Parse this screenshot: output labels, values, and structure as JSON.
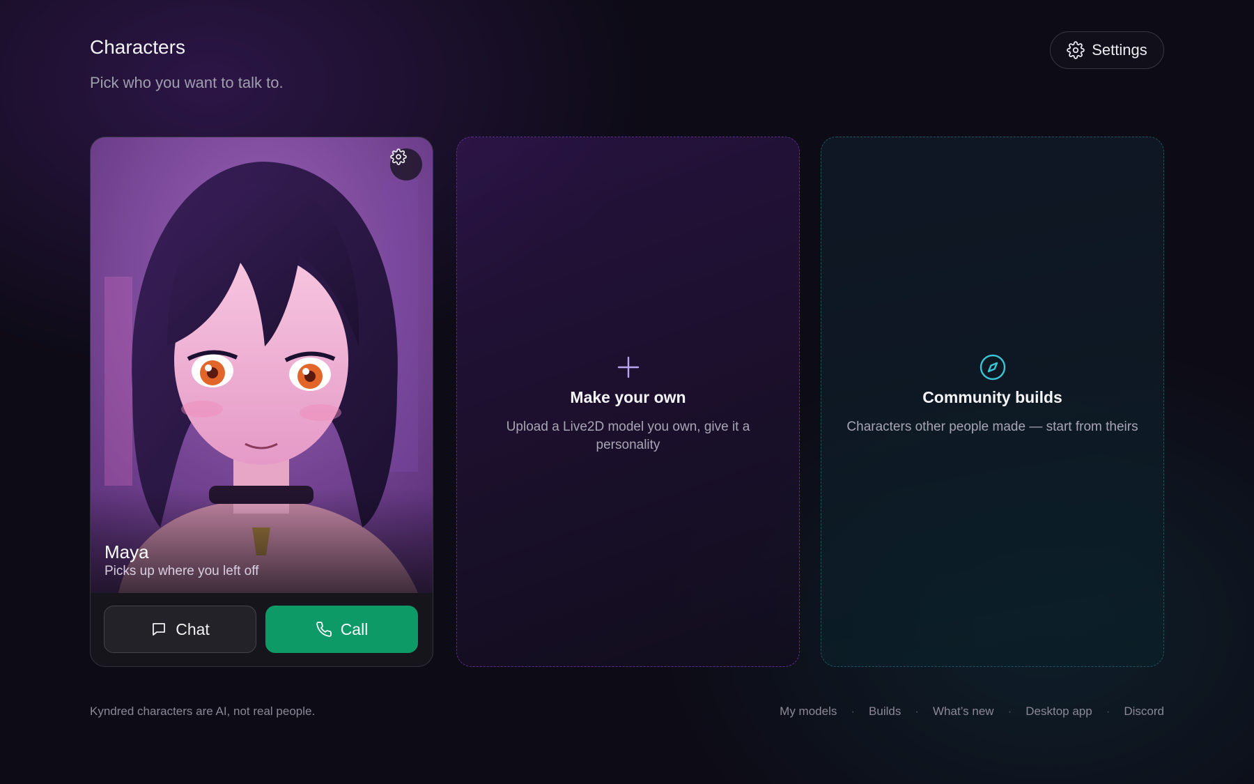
{
  "header": {
    "title": "Characters",
    "subtitle": "Pick who you want to talk to.",
    "settings_label": "Settings"
  },
  "character": {
    "name": "Maya",
    "tagline": "Picks up where you left off",
    "chat_label": "Chat",
    "call_label": "Call"
  },
  "make_own": {
    "title": "Make your own",
    "description": "Upload a Live2D model you own, give it a personality",
    "icon": "plus-icon"
  },
  "community": {
    "title": "Community builds",
    "description": "Characters other people made — start from theirs",
    "icon": "compass-icon"
  },
  "footer": {
    "note": "Kyndred characters are AI, not real people.",
    "links": [
      "My models",
      "Builds",
      "What’s new",
      "Desktop app",
      "Discord"
    ]
  },
  "colors": {
    "call_button": "#0e9a66",
    "make_border": "#5a2f8a",
    "community_border": "#1d5560",
    "compass_accent": "#39c6d6",
    "plus_accent": "#b9a4f2"
  }
}
